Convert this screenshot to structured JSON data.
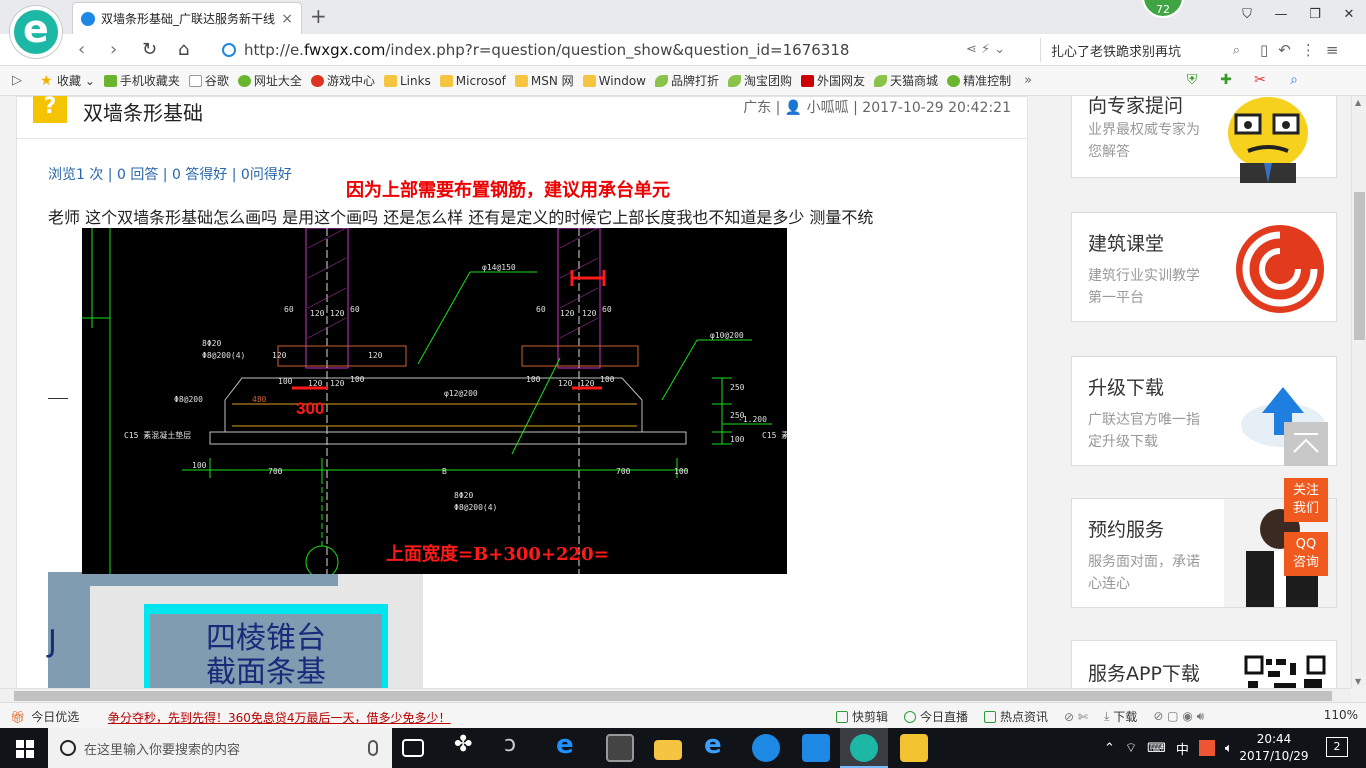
{
  "tab": {
    "title": "双墙条形基础_广联达服务新干线",
    "close": "×",
    "new_tab": "+"
  },
  "badge": {
    "count": "72"
  },
  "window": {
    "controls": [
      "⛉",
      "—",
      "❐",
      "✕"
    ]
  },
  "navigation": {
    "back": "‹",
    "forward": "›",
    "reload": "↻",
    "home": "⌂"
  },
  "address": {
    "url_prefix": "http://e.",
    "url_domain": "fwxgx.com",
    "url_rest": "/index.php?r=question/question_show&question_id=1676318"
  },
  "search": {
    "text": "扎心了老铁跪求别再坑"
  },
  "favorites": [
    {
      "label": "收藏",
      "icon": "star-icon"
    },
    {
      "label": "手机收藏夹",
      "icon": "phone-icon"
    },
    {
      "label": "谷歌",
      "icon": "page-icon"
    },
    {
      "label": "网址大全",
      "icon": "green-icon"
    },
    {
      "label": "游戏中心",
      "icon": "red-icon"
    },
    {
      "label": "Links",
      "icon": "folder-icon"
    },
    {
      "label": "Microsof",
      "icon": "folder-icon"
    },
    {
      "label": "MSN 网",
      "icon": "folder-icon"
    },
    {
      "label": "Window",
      "icon": "folder-icon"
    },
    {
      "label": "品牌打折",
      "icon": "leaf-icon"
    },
    {
      "label": "淘宝团购",
      "icon": "leaf-icon"
    },
    {
      "label": "外国网友",
      "icon": "tmall-icon"
    },
    {
      "label": "天猫商城",
      "icon": "leaf-icon"
    },
    {
      "label": "精准控制",
      "icon": "green-icon"
    }
  ],
  "fav_more": "»",
  "question": {
    "title": "双墙条形基础",
    "meta": "广东 | 👤 小呱呱 | 2017-10-29 20:42:21",
    "icon": "?",
    "stats": "浏览1 次 | 0 回答 | 0 答得好 | 0问得好",
    "red_note": "因为上部需要布置钢筋，建议用承台单元",
    "body": "老师 这个双墙条形基础怎么画吗 是用这个画吗 还是怎么样 还有是定义的时候它上部长度我也不知道是多少 测量不统"
  },
  "cad": {
    "labels": {
      "d14": "φ14@150",
      "d10": "φ10@200",
      "d12": "φ12@200",
      "d8a": "8Φ20",
      "d8b": "Φ8@200(4)",
      "d8c": "Φ8@200",
      "d8d": "8Φ20",
      "d8e": "Φ8@200(4)",
      "c15a": "C15 素混凝土垫层",
      "c15b": "C15 素",
      "b": "B",
      "w700a": "700",
      "w700b": "700",
      "w100a": "100",
      "w100b": "100",
      "w60a": "60",
      "w120a": "120",
      "w120b": "120",
      "w60b": "60",
      "w60c": "60",
      "w120c": "120",
      "w120d": "120",
      "w60d": "60",
      "v250a": "250",
      "v250b": "250",
      "v100": "100",
      "lv": "-1.200",
      "v120a": "120",
      "v120b": "120",
      "w100c": "100",
      "w120e": "120",
      "w120f": "120",
      "w100d": "100",
      "w100e": "100",
      "w120g": "120",
      "w120h": "120",
      "w100f": "100",
      "w480": "480",
      "red300": "300",
      "formula": "上面宽度=B+300+220="
    }
  },
  "thumb": {
    "text1": "四棱锥台",
    "text2": "截面条基",
    "left_letter": "J"
  },
  "sidebar": [
    {
      "title": "向专家提问",
      "sub": "业界最权威专家为您解答"
    },
    {
      "title": "建筑课堂",
      "sub": "建筑行业实训教学第一平台"
    },
    {
      "title": "升级下载",
      "sub": "广联达官方唯一指定升级下载"
    },
    {
      "title": "预约服务",
      "sub": "服务面对面，承诺心连心"
    },
    {
      "title": "服务APP下载",
      "sub": ""
    }
  ],
  "floating": {
    "follow": "关注\n我们",
    "qq": "QQ\n咨询"
  },
  "status": {
    "today": "今日优选",
    "promo": "争分夺秒，先到先得！360免息贷4万最后一天，借多少免多少！",
    "items": [
      "快剪辑",
      "今日直播",
      "热点资讯",
      "下载"
    ],
    "zoom": "110%"
  },
  "taskbar": {
    "search_placeholder": "在这里输入你要搜索的内容",
    "ime": "中",
    "time": "20:44",
    "date": "2017/10/29",
    "notifications": "2"
  },
  "colors": {
    "accent": "#1db7a6",
    "cad_bg": "#000000",
    "cad_green": "#18e018",
    "cad_red": "#ff1a1a",
    "float_orange": "#f05a1e"
  }
}
